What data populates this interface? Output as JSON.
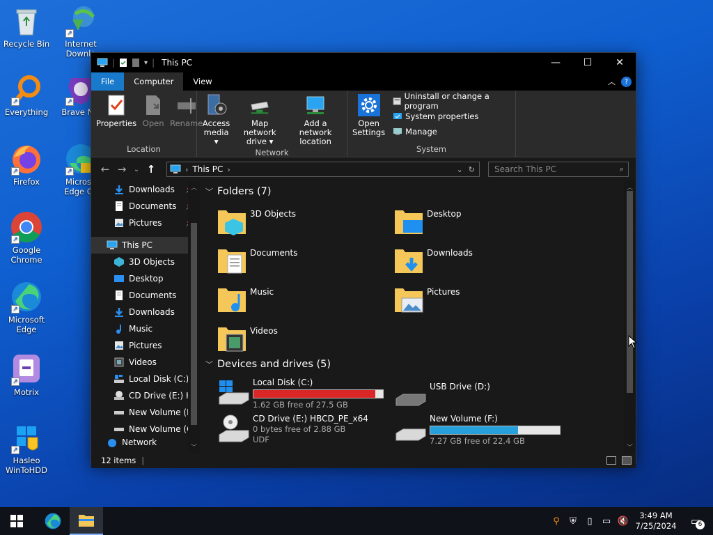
{
  "desktop_icons": [
    {
      "label": "Recycle Bin",
      "icon": "recycle-bin-icon"
    },
    {
      "label": "Everything",
      "icon": "everything-search-icon"
    },
    {
      "label": "Firefox",
      "icon": "firefox-icon"
    },
    {
      "label": "Google Chrome",
      "icon": "chrome-icon"
    },
    {
      "label": "Microsoft Edge",
      "icon": "edge-icon"
    },
    {
      "label": "Motrix",
      "icon": "motrix-icon"
    },
    {
      "label": "Hasleo WinToHDD",
      "icon": "wintohdd-icon"
    },
    {
      "label": "Internet Downlo",
      "icon": "idm-icon"
    },
    {
      "label": "Brave Nic",
      "icon": "brave-icon"
    },
    {
      "label": "Microso Edge Ca",
      "icon": "edge-canary-icon"
    }
  ],
  "window": {
    "title": "This PC",
    "controls": {
      "minimize": "—",
      "maximize": "☐",
      "close": "✕"
    }
  },
  "menu": {
    "file": "File",
    "computer": "Computer",
    "view": "View"
  },
  "ribbon": {
    "location": {
      "label": "Location",
      "properties": "Properties",
      "open": "Open",
      "rename": "Rename"
    },
    "network": {
      "label": "Network",
      "access_media_1": "Access",
      "access_media_2": "media ▾",
      "map_drive_1": "Map network",
      "map_drive_2": "drive ▾",
      "add_location_1": "Add a network",
      "add_location_2": "location"
    },
    "system": {
      "label": "System",
      "open_settings_1": "Open",
      "open_settings_2": "Settings",
      "uninstall": "Uninstall or change a program",
      "system_properties": "System properties",
      "manage": "Manage"
    }
  },
  "address": {
    "path": "This PC",
    "search_placeholder": "Search This PC"
  },
  "nav": {
    "quick_access": [
      {
        "label": "Downloads",
        "pinned": true
      },
      {
        "label": "Documents",
        "pinned": true
      },
      {
        "label": "Pictures",
        "pinned": true
      }
    ],
    "this_pc": "This PC",
    "pc_items": [
      "3D Objects",
      "Desktop",
      "Documents",
      "Downloads",
      "Music",
      "Pictures",
      "Videos",
      "Local Disk (C:)",
      "CD Drive (E:) HB",
      "New Volume (F:)",
      "New Volume (G:"
    ],
    "network": "Network"
  },
  "folders": {
    "header": "Folders (7)",
    "items": [
      "3D Objects",
      "Desktop",
      "Documents",
      "Downloads",
      "Music",
      "Pictures",
      "Videos"
    ]
  },
  "drives": {
    "header": "Devices and drives (5)",
    "items": [
      {
        "name": "Local Disk (C:)",
        "free": "1.62 GB free of 27.5 GB",
        "used_fraction": 0.94,
        "bar_color": "#da2626",
        "has_bar": true
      },
      {
        "name": "USB Drive (D:)",
        "free": "",
        "used_fraction": 0,
        "bar_color": "",
        "has_bar": false
      },
      {
        "name": "CD Drive (E:) HBCD_PE_x64",
        "free": "0 bytes free of 2.88 GB",
        "fs": "UDF",
        "used_fraction": 1.0,
        "has_bar": false
      },
      {
        "name": "New Volume (F:)",
        "free": "7.27 GB free of 22.4 GB",
        "used_fraction": 0.68,
        "bar_color": "#26a0da",
        "has_bar": true
      }
    ]
  },
  "status": {
    "count": "12 items"
  },
  "taskbar": {
    "time": "3:49 AM",
    "date": "7/25/2024",
    "notifications": "6"
  }
}
